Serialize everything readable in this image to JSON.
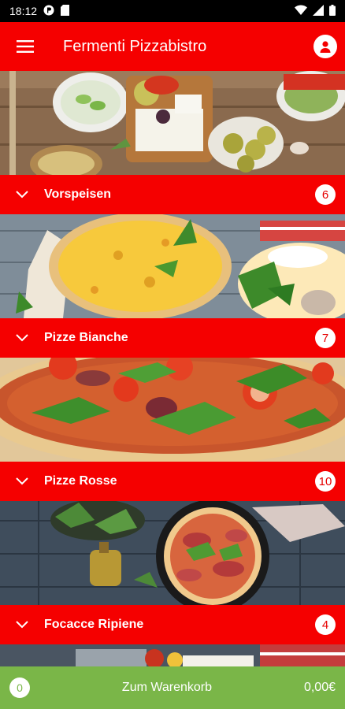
{
  "status": {
    "time": "18:12"
  },
  "appbar": {
    "title": "Fermenti Pizzabistro"
  },
  "categories": [
    {
      "name": "Vorspeisen",
      "count": "6"
    },
    {
      "name": "Pizze Bianche",
      "count": "7"
    },
    {
      "name": "Pizze Rosse",
      "count": "10"
    },
    {
      "name": "Focacce Ripiene",
      "count": "4"
    }
  ],
  "cart": {
    "count": "0",
    "label": "Zum Warenkorb",
    "total": "0,00€"
  },
  "colors": {
    "brand_red": "#f50000",
    "cart_green": "#7ab648"
  }
}
